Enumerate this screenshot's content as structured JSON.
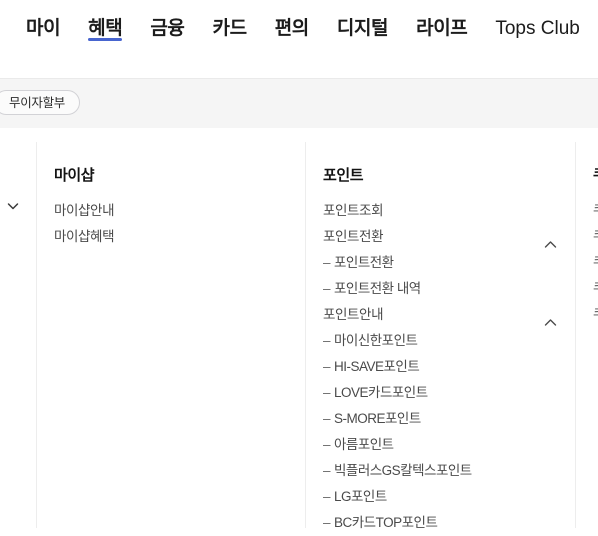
{
  "topnav": {
    "tabs": [
      {
        "label": "마이",
        "active": false,
        "latin": false
      },
      {
        "label": "혜택",
        "active": true,
        "latin": false
      },
      {
        "label": "금융",
        "active": false,
        "latin": false
      },
      {
        "label": "카드",
        "active": false,
        "latin": false
      },
      {
        "label": "편의",
        "active": false,
        "latin": false
      },
      {
        "label": "디지털",
        "active": false,
        "latin": false
      },
      {
        "label": "라이프",
        "active": false,
        "latin": false
      },
      {
        "label": "Tops Club",
        "active": false,
        "latin": true
      }
    ],
    "active_underline_color": "#4865cf"
  },
  "filter_bar": {
    "chips": [
      {
        "label": "무이자할부",
        "selected": false
      }
    ]
  },
  "panel": {
    "collapse_icon": "chevron-down-icon",
    "columns": [
      {
        "title": "마이샵",
        "items": [
          {
            "label": "마이샵안내",
            "type": "link"
          },
          {
            "label": "마이샵혜택",
            "type": "link"
          }
        ]
      },
      {
        "title": "포인트",
        "items": [
          {
            "label": "포인트조회",
            "type": "link"
          },
          {
            "label": "포인트전환",
            "type": "group",
            "expanded": true,
            "icon": "chevron-up-icon",
            "children": [
              {
                "label": "포인트전환"
              },
              {
                "label": "포인트전환 내역"
              }
            ]
          },
          {
            "label": "포인트안내",
            "type": "group",
            "expanded": true,
            "icon": "chevron-up-icon",
            "children": [
              {
                "label": "마이신한포인트"
              },
              {
                "label": "HI-SAVE포인트"
              },
              {
                "label": "LOVE카드포인트"
              },
              {
                "label": "S-MORE포인트"
              },
              {
                "label": "아름포인트"
              },
              {
                "label": "빅플러스GS칼텍스포인트"
              },
              {
                "label": "LG포인트"
              },
              {
                "label": "BC카드TOP포인트"
              }
            ]
          }
        ]
      },
      {
        "title": "쿠",
        "items": [
          {
            "label": "쿠",
            "type": "link"
          },
          {
            "label": "쿠",
            "type": "link"
          },
          {
            "label": "쿠",
            "type": "link"
          },
          {
            "label": "쿠",
            "type": "link"
          },
          {
            "label": "쿠",
            "type": "link"
          }
        ]
      }
    ]
  }
}
